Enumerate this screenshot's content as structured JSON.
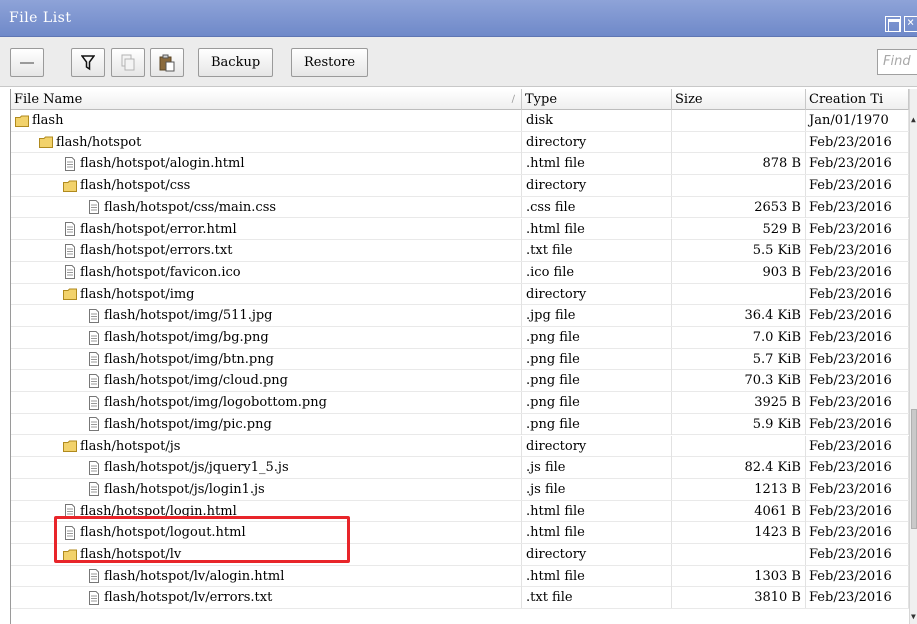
{
  "window": {
    "title": "File List"
  },
  "toolbar": {
    "backup_label": "Backup",
    "restore_label": "Restore",
    "find_placeholder": "Find",
    "icons": [
      "minus-icon",
      "filter-icon",
      "copy-icon",
      "paste-icon"
    ]
  },
  "table": {
    "columns": [
      "File Name",
      "Type",
      "Size",
      "Creation Ti"
    ],
    "rows": [
      {
        "name": "flash",
        "icon": "folder",
        "depth": 0,
        "type": "disk",
        "size": "",
        "date": "Jan/01/1970"
      },
      {
        "name": "flash/hotspot",
        "icon": "folder",
        "depth": 1,
        "type": "directory",
        "size": "",
        "date": "Feb/23/2016"
      },
      {
        "name": "flash/hotspot/alogin.html",
        "icon": "file",
        "depth": 2,
        "type": ".html file",
        "size": "878 B",
        "date": "Feb/23/2016"
      },
      {
        "name": "flash/hotspot/css",
        "icon": "folder",
        "depth": 2,
        "type": "directory",
        "size": "",
        "date": "Feb/23/2016"
      },
      {
        "name": "flash/hotspot/css/main.css",
        "icon": "file",
        "depth": 3,
        "type": ".css file",
        "size": "2653 B",
        "date": "Feb/23/2016"
      },
      {
        "name": "flash/hotspot/error.html",
        "icon": "file",
        "depth": 2,
        "type": ".html file",
        "size": "529 B",
        "date": "Feb/23/2016"
      },
      {
        "name": "flash/hotspot/errors.txt",
        "icon": "file",
        "depth": 2,
        "type": ".txt file",
        "size": "5.5 KiB",
        "date": "Feb/23/2016"
      },
      {
        "name": "flash/hotspot/favicon.ico",
        "icon": "file",
        "depth": 2,
        "type": ".ico file",
        "size": "903 B",
        "date": "Feb/23/2016"
      },
      {
        "name": "flash/hotspot/img",
        "icon": "folder",
        "depth": 2,
        "type": "directory",
        "size": "",
        "date": "Feb/23/2016"
      },
      {
        "name": "flash/hotspot/img/511.jpg",
        "icon": "file",
        "depth": 3,
        "type": ".jpg file",
        "size": "36.4 KiB",
        "date": "Feb/23/2016"
      },
      {
        "name": "flash/hotspot/img/bg.png",
        "icon": "file",
        "depth": 3,
        "type": ".png file",
        "size": "7.0 KiB",
        "date": "Feb/23/2016"
      },
      {
        "name": "flash/hotspot/img/btn.png",
        "icon": "file",
        "depth": 3,
        "type": ".png file",
        "size": "5.7 KiB",
        "date": "Feb/23/2016"
      },
      {
        "name": "flash/hotspot/img/cloud.png",
        "icon": "file",
        "depth": 3,
        "type": ".png file",
        "size": "70.3 KiB",
        "date": "Feb/23/2016"
      },
      {
        "name": "flash/hotspot/img/logobottom.png",
        "icon": "file",
        "depth": 3,
        "type": ".png file",
        "size": "3925 B",
        "date": "Feb/23/2016"
      },
      {
        "name": "flash/hotspot/img/pic.png",
        "icon": "file",
        "depth": 3,
        "type": ".png file",
        "size": "5.9 KiB",
        "date": "Feb/23/2016"
      },
      {
        "name": "flash/hotspot/js",
        "icon": "folder",
        "depth": 2,
        "type": "directory",
        "size": "",
        "date": "Feb/23/2016"
      },
      {
        "name": "flash/hotspot/js/jquery1_5.js",
        "icon": "file",
        "depth": 3,
        "type": ".js file",
        "size": "82.4 KiB",
        "date": "Feb/23/2016"
      },
      {
        "name": "flash/hotspot/js/login1.js",
        "icon": "file",
        "depth": 3,
        "type": ".js file",
        "size": "1213 B",
        "date": "Feb/23/2016"
      },
      {
        "name": "flash/hotspot/login.html",
        "icon": "file",
        "depth": 2,
        "type": ".html file",
        "size": "4061 B",
        "date": "Feb/23/2016"
      },
      {
        "name": "flash/hotspot/logout.html",
        "icon": "file",
        "depth": 2,
        "type": ".html file",
        "size": "1423 B",
        "date": "Feb/23/2016"
      },
      {
        "name": "flash/hotspot/lv",
        "icon": "folder",
        "depth": 2,
        "type": "directory",
        "size": "",
        "date": "Feb/23/2016"
      },
      {
        "name": "flash/hotspot/lv/alogin.html",
        "icon": "file",
        "depth": 3,
        "type": ".html file",
        "size": "1303 B",
        "date": "Feb/23/2016"
      },
      {
        "name": "flash/hotspot/lv/errors.txt",
        "icon": "file",
        "depth": 3,
        "type": ".txt file",
        "size": "3810 B",
        "date": "Feb/23/2016"
      }
    ]
  },
  "colors": {
    "titlebar": "#7b92cf",
    "highlight": "#e8252a",
    "folder": "#f2d26b"
  }
}
